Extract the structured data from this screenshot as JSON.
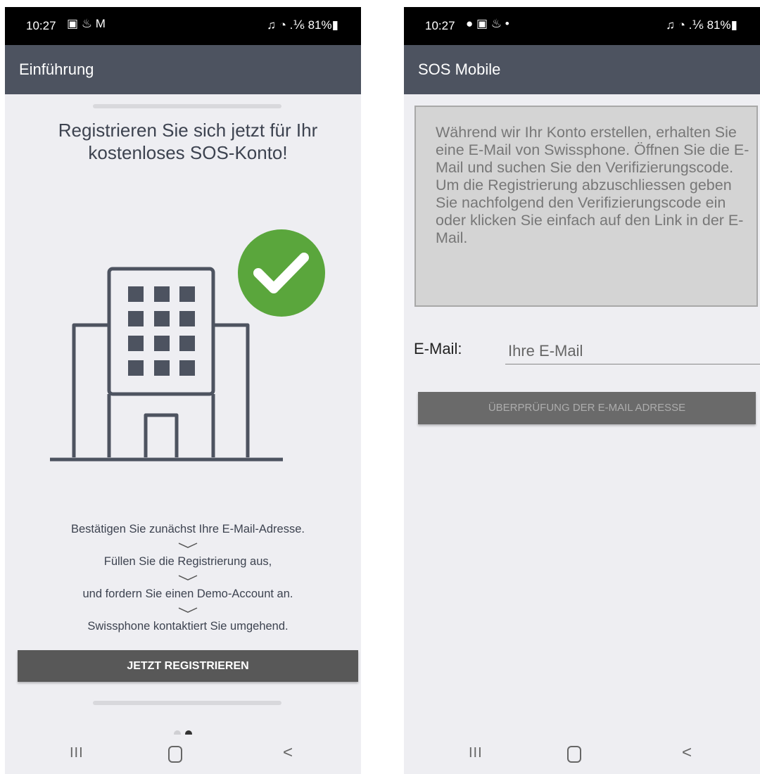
{
  "left": {
    "status": {
      "time": "10:27",
      "icons": "▣ ♨ M",
      "right": "♫ ◔ .⅙ 81%▮"
    },
    "title": "Einführung",
    "headline": "Registrieren Sie sich jetzt für Ihr kostenloses SOS-Konto!",
    "steps": [
      "Bestätigen Sie zunächst Ihre E-Mail-Adresse.",
      "Füllen Sie die Registrierung aus,",
      "und fordern Sie einen Demo-Account an.",
      "Swissphone kontaktiert Sie umgehend."
    ],
    "button": "JETZT REGISTRIEREN",
    "page_indicator": {
      "count": 2,
      "active": 1
    },
    "colors": {
      "check": "#5aa63c",
      "building": "#4d5360"
    }
  },
  "right": {
    "status": {
      "time": "10:27",
      "icons": "● ▣ ♨ •",
      "right": "♫ ◔ .⅙ 81%▮"
    },
    "title": "SOS Mobile",
    "info": "Während wir Ihr Konto erstellen, erhalten Sie eine E-Mail von Swissphone. Öffnen Sie die E-Mail und suchen Sie den Verifizierungscode. Um die Registrierung abzuschliessen geben Sie nachfolgend den Verifizierungscode ein oder klicken Sie einfach auf den Link in der E-Mail.",
    "email_label": "E-Mail:",
    "email_placeholder": "Ihre E-Mail",
    "email_value": "",
    "button": "ÜBERPRÜFUNG DER E-MAIL ADRESSE"
  },
  "nav": {
    "recent": "III",
    "back": "<"
  }
}
